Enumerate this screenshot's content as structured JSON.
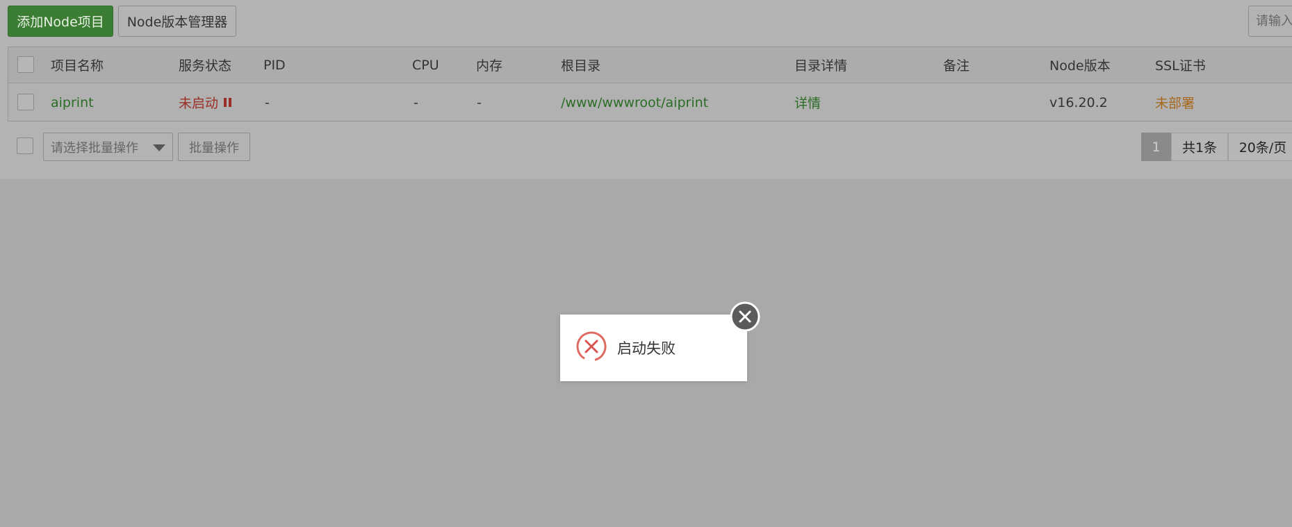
{
  "toolbar": {
    "add_label": "添加Node项目",
    "manager_label": "Node版本管理器",
    "search_placeholder": "请输入"
  },
  "table": {
    "columns": [
      "项目名称",
      "服务状态",
      "PID",
      "CPU",
      "内存",
      "根目录",
      "目录详情",
      "备注",
      "Node版本",
      "SSL证书"
    ],
    "rows": [
      {
        "name": "aiprint",
        "status": "未启动",
        "pid": "-",
        "cpu": "-",
        "mem": "-",
        "root": "/www/wwwroot/aiprint",
        "detail": "详情",
        "note": "",
        "node_version": "v16.20.2",
        "ssl": "未部署"
      }
    ]
  },
  "footer": {
    "batch_select_placeholder": "请选择批量操作",
    "batch_button": "批量操作",
    "pager": {
      "current": "1",
      "total": "共1条",
      "page_size": "20条/页"
    }
  },
  "toast": {
    "message": "启动失败",
    "icon": "error-x-icon",
    "close_icon": "close-circle-icon"
  },
  "colors": {
    "primary_green": "#3a7d33",
    "error_red": "#d9534f",
    "overlay": "#a9a9a9"
  }
}
